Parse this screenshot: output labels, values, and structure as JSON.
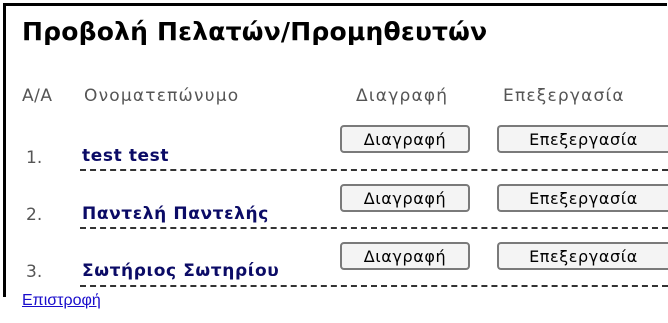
{
  "page": {
    "title": "Προβολή Πελατών/Προμηθευτών",
    "back_link": "Επιστροφή"
  },
  "table": {
    "headers": {
      "index": "Α/Α",
      "name": "Ονοματεπώνυμο",
      "delete": "Διαγραφή",
      "edit": "Επεξεργασία"
    },
    "rows": [
      {
        "num": "1.",
        "name": "test test",
        "delete_label": "Διαγραφή",
        "edit_label": "Επεξεργασία"
      },
      {
        "num": "2.",
        "name": "Παντελή Παντελής",
        "delete_label": "Διαγραφή",
        "edit_label": "Επεξεργασία"
      },
      {
        "num": "3.",
        "name": "Σωτήριος Σωτηρίου",
        "delete_label": "Διαγραφή",
        "edit_label": "Επεξεργασία"
      }
    ]
  }
}
